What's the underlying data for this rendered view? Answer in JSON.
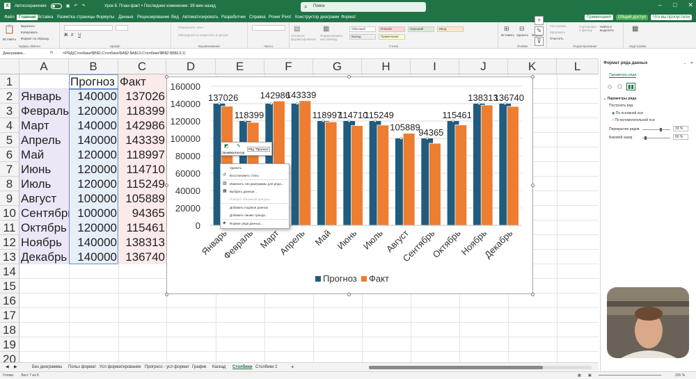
{
  "titlebar": {
    "autosave": "Автосохранение",
    "doc_title": "Урок 8. План-факт • Последнее изменение: 39 мин назад",
    "search": "Поиск"
  },
  "tabs": [
    "Файл",
    "Главная",
    "Вставка",
    "Разметка страницы",
    "Формулы",
    "Данные",
    "Рецензирование",
    "Вид",
    "Автоматизировать",
    "Разработчик",
    "Справка",
    "Power Pivot",
    "Конструктор диаграмм",
    "Формат"
  ],
  "tabs_right": {
    "notes": "Примечания",
    "share": "Общий доступ",
    "missing": "Что вы пропустили"
  },
  "ribbon": {
    "paste": "Вставить",
    "cut": "Вырезать",
    "copy": "Копировать",
    "format_painter": "Формат по образцу",
    "clipboard": "Буфер обмена",
    "font": "Шрифт",
    "alignment": "Выравнивание",
    "wrap": "Переносить текст",
    "merge": "Объединить и поместить в центре",
    "number": "Число",
    "styles": "Стили",
    "conditional": "Условное форматирование",
    "format_table": "Форматировать как таблицу",
    "style_cells": [
      "Обычный",
      "Плохой",
      "Хороший",
      "Ввод",
      "Вывод",
      "Примечание"
    ],
    "cells": "Ячейки",
    "insert": "Вставить",
    "delete": "Удалить",
    "format": "Формат",
    "editing": "Редактирование",
    "autosum": "Автосумма",
    "fill": "Заполнить",
    "clear": "Очистить",
    "sort": "Сортировка и фильтр",
    "find": "Найти и выделить",
    "addins": "Надстройки"
  },
  "formulabar": {
    "namebox": "Диаграмма...",
    "fx": "fx",
    "formula": "=РЯД(Столбики!$B$1;Столбики!$A$2:$A$13;Столбики!$B$2:$B$13;1)"
  },
  "columns": [
    "A",
    "B",
    "C",
    "D",
    "E",
    "F",
    "G",
    "H",
    "I",
    "J",
    "K",
    "L"
  ],
  "rows": [
    "1",
    "2",
    "3",
    "4",
    "5",
    "6",
    "7",
    "8",
    "9",
    "10",
    "11",
    "12",
    "13",
    "14",
    "15",
    "16",
    "17",
    "18",
    "19",
    "20"
  ],
  "table": {
    "header": [
      "",
      "Прогноз",
      "Факт"
    ],
    "rows": [
      [
        "Январь",
        "140000",
        "137026"
      ],
      [
        "Февраль",
        "120000",
        "118399"
      ],
      [
        "Март",
        "140000",
        "142986"
      ],
      [
        "Апрель",
        "140000",
        "143339"
      ],
      [
        "Май",
        "120000",
        "118997"
      ],
      [
        "Июнь",
        "120000",
        "114710"
      ],
      [
        "Июль",
        "120000",
        "115249"
      ],
      [
        "Август",
        "100000",
        "105889"
      ],
      [
        "Сентябрь",
        "100000",
        "94365"
      ],
      [
        "Октябрь",
        "120000",
        "115461"
      ],
      [
        "Ноябрь",
        "140000",
        "138313"
      ],
      [
        "Декабрь",
        "140000",
        "136740"
      ]
    ]
  },
  "chart_data": {
    "type": "bar",
    "categories": [
      "Январь",
      "Февраль",
      "Март",
      "Апрель",
      "Май",
      "Июнь",
      "Июль",
      "Август",
      "Сентябрь",
      "Октябрь",
      "Ноябрь",
      "Декабрь"
    ],
    "series": [
      {
        "name": "Прогноз",
        "color": "#1f5c7f",
        "values": [
          140000,
          120000,
          140000,
          140000,
          120000,
          120000,
          120000,
          100000,
          100000,
          120000,
          140000,
          140000
        ]
      },
      {
        "name": "Факт",
        "color": "#ed7d31",
        "values": [
          137026,
          118399,
          142986,
          143339,
          118997,
          114710,
          115249,
          105889,
          94365,
          115461,
          138313,
          136740
        ]
      }
    ],
    "data_labels": [
      "137026",
      "118399",
      "142986",
      "143339",
      "118997",
      "114710",
      "115249",
      "105889",
      "94365",
      "115461",
      "138313",
      "136740"
    ],
    "ylim": [
      0,
      160000
    ],
    "yticks": [
      "0",
      "20000",
      "40000",
      "60000",
      "80000",
      "100000",
      "120000",
      "140000",
      "160000"
    ],
    "grid": true,
    "legend": "bottom"
  },
  "minitoolbar": {
    "fill": "Заливка",
    "outline": "Контур",
    "series": "Ряд \"Прогноз\""
  },
  "context_menu": [
    {
      "label": "Удалить",
      "disabled": false,
      "icon": ""
    },
    {
      "label": "Восстановить стиль",
      "disabled": false,
      "icon": "↺"
    },
    {
      "label": "Изменить тип диаграммы для ряда...",
      "disabled": false,
      "icon": "▥"
    },
    {
      "label": "Выбрать данные...",
      "disabled": false,
      "icon": "▦"
    },
    {
      "label": "Поворот объемной фигуры...",
      "disabled": true,
      "icon": ""
    },
    {
      "label": "Добавить подписи данных",
      "disabled": false,
      "icon": ""
    },
    {
      "label": "Добавить линию тренда...",
      "disabled": false,
      "icon": ""
    },
    {
      "label": "Формат ряда данных...",
      "disabled": false,
      "icon": "◈"
    }
  ],
  "sheets": [
    "Без диаграммы",
    "Польз формат",
    "Усл форматирование",
    "Прогресс - усл формат",
    "График",
    "Каскад",
    "Столбики",
    "Столбики 2"
  ],
  "active_sheet": "Столбики",
  "status": {
    "ready": "Готово",
    "sheet": "Лист 7 из 8",
    "zoom": "226 %"
  },
  "pane": {
    "title": "Формат ряда данных",
    "subtitle": "Параметры ряда",
    "section": "Параметры ряда",
    "plot_on": "Построить ряд",
    "primary": "По основной оси",
    "secondary": "По вспомогательной оси",
    "overlap_label": "Перекрытие рядов",
    "overlap_value": "33 %",
    "overlap_level": 0.665,
    "gap_label": "Боковой зазор",
    "gap_value": "60 %",
    "gap_level": 0.12
  }
}
